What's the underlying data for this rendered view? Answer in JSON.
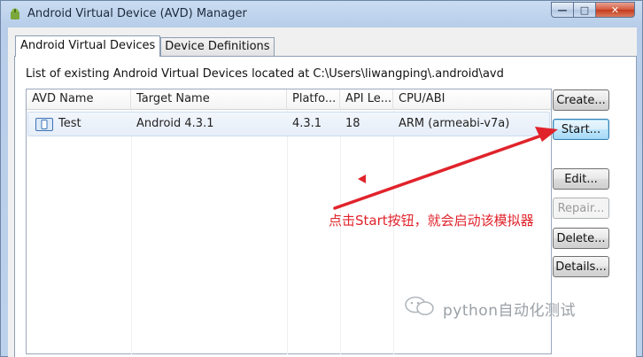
{
  "window": {
    "title": "Android Virtual Device (AVD) Manager",
    "caption": {
      "minimize": "—",
      "maximize": "□",
      "close": "✕"
    }
  },
  "tabs": [
    {
      "label": "Android Virtual Devices",
      "active": true
    },
    {
      "label": "Device Definitions",
      "active": false
    }
  ],
  "description": "List of existing Android Virtual Devices located at C:\\Users\\liwangping\\.android\\avd",
  "table": {
    "columns": [
      "AVD Name",
      "Target Name",
      "Platfo...",
      "API Le...",
      "CPU/ABI"
    ],
    "rows": [
      {
        "name": "Test",
        "target": "Android 4.3.1",
        "platform": "4.3.1",
        "api": "18",
        "cpu": "ARM (armeabi-v7a)",
        "icon": "avd-device-icon"
      }
    ]
  },
  "buttons": {
    "create": "Create...",
    "start": "Start...",
    "edit": "Edit...",
    "repair": "Repair...",
    "delete": "Delete...",
    "details": "Details..."
  },
  "annotation": {
    "text": "点击Start按钮，就会启动该模拟器",
    "color": "#e0232b"
  },
  "watermark": {
    "text": "python自动化测试",
    "icon": "wechat-icon"
  },
  "colors": {
    "title_bar": "#c9dcf1",
    "selected_row": "#e6eef9",
    "arrow": "#e0232b"
  }
}
